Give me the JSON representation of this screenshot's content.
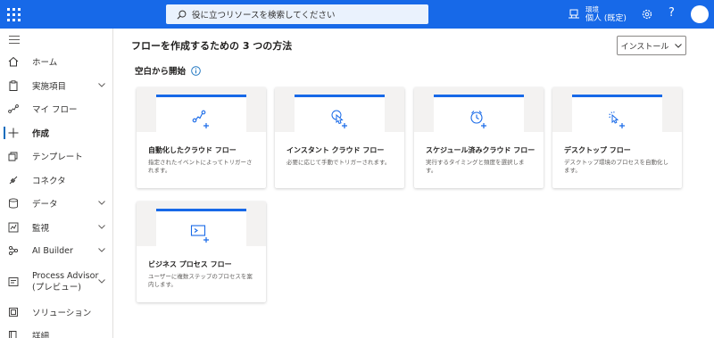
{
  "topbar": {
    "search_placeholder": "役に立つリソースを検索してください",
    "env_label": "環境",
    "env_name": "個人 (既定)",
    "help": "?",
    "accent": "#1769e8"
  },
  "sidebar": {
    "items": [
      {
        "label": "ホーム",
        "icon": "home-icon",
        "chevron": false
      },
      {
        "label": "実施項目",
        "icon": "clipboard-icon",
        "chevron": true
      },
      {
        "label": "マイ フロー",
        "icon": "flow-icon",
        "chevron": false
      },
      {
        "label": "作成",
        "icon": "plus-icon",
        "chevron": false,
        "active": true
      },
      {
        "label": "テンプレート",
        "icon": "template-icon",
        "chevron": false
      },
      {
        "label": "コネクタ",
        "icon": "connector-icon",
        "chevron": false
      },
      {
        "label": "データ",
        "icon": "database-icon",
        "chevron": true
      },
      {
        "label": "監視",
        "icon": "monitor-icon",
        "chevron": true
      },
      {
        "label": "AI Builder",
        "icon": "ai-builder-icon",
        "chevron": true
      },
      {
        "label": "Process Advisor",
        "label2": "(プレビュー)",
        "icon": "process-advisor-icon",
        "chevron": true
      },
      {
        "label": "ソリューション",
        "icon": "solution-icon",
        "chevron": false
      },
      {
        "label": "詳細",
        "icon": "book-icon",
        "chevron": false
      }
    ]
  },
  "main": {
    "title": "フローを作成するための 3 つの方法",
    "install_label": "インストール",
    "section_title": "空白から開始",
    "cards": [
      {
        "title": "自動化したクラウド フロー",
        "desc": "指定されたイベントによってトリガーされます。",
        "icon": "automated-flow-icon"
      },
      {
        "title": "インスタント クラウド フロー",
        "desc": "必要に応じて手動でトリガーされます。",
        "icon": "instant-flow-icon"
      },
      {
        "title": "スケジュール済みクラウド フロー",
        "desc": "実行するタイミングと頻度を選択します。",
        "icon": "scheduled-flow-icon"
      },
      {
        "title": "デスクトップ フロー",
        "desc": "デスクトップ環境のプロセスを自動化します。",
        "icon": "desktop-flow-icon"
      },
      {
        "title": "ビジネス プロセス フロー",
        "desc": "ユーザーに複数ステップのプロセスを案内します。",
        "icon": "business-process-flow-icon"
      }
    ]
  }
}
